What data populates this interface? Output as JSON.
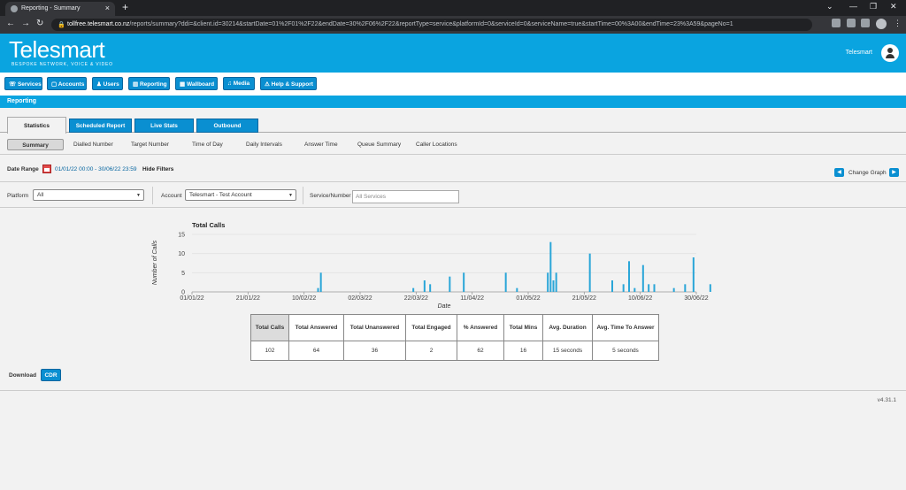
{
  "browser": {
    "tab_title": "Reporting - Summary",
    "url_host": "tollfree.telesmart.co.nz",
    "url_path": "/reports/summary?ddi=&client.id=30214&startDate=01%2F01%2F22&endDate=30%2F06%2F22&reportType=service&platformId=0&serviceId=0&serviceName=true&startTime=00%3A00&endTime=23%3A59&pageNo=1"
  },
  "header": {
    "logo_name": "Telesmart",
    "logo_tagline": "BESPOKE NETWORK, VOICE & VIDEO",
    "user_name": "Telesmart"
  },
  "menu": {
    "items": [
      "Services",
      "Accounts",
      "Users",
      "Reporting",
      "Wallboard",
      "Media",
      "Help & Support"
    ]
  },
  "section_title": "Reporting",
  "tabs": [
    "Statistics",
    "Scheduled Report",
    "Live Stats",
    "Outbound"
  ],
  "subtabs": [
    "Summary",
    "Dialled Number",
    "Target Number",
    "Time of Day",
    "Daily Intervals",
    "Answer Time",
    "Queue Summary",
    "Caller Locations"
  ],
  "date_range": {
    "label": "Date Range",
    "value": "01/01/22 00:00 - 30/06/22 23:59",
    "hide_filters": "Hide Filters",
    "change_graph": "Change Graph"
  },
  "filters": {
    "platform_label": "Platform",
    "platform_value": "All",
    "account_label": "Account",
    "account_value": "Telesmart - Test Account",
    "service_label": "Service/Number",
    "service_placeholder": "All Services"
  },
  "chart_data": {
    "type": "bar",
    "title": "Total Calls",
    "xlabel": "Date",
    "ylabel": "Number of Calls",
    "ylim": [
      0,
      15
    ],
    "yticks": [
      0,
      5,
      10,
      15
    ],
    "x_range": [
      "01/01/22",
      "30/06/22"
    ],
    "xticks": [
      "01/01/22",
      "21/01/22",
      "10/02/22",
      "02/03/22",
      "22/03/22",
      "11/04/22",
      "01/05/22",
      "21/05/22",
      "10/06/22",
      "30/06/22"
    ],
    "color": "#2aa6d8",
    "grid": true,
    "points": [
      {
        "x": "15/02/22",
        "y": 1
      },
      {
        "x": "16/02/22",
        "y": 5
      },
      {
        "x": "21/03/22",
        "y": 1
      },
      {
        "x": "25/03/22",
        "y": 3
      },
      {
        "x": "27/03/22",
        "y": 2
      },
      {
        "x": "03/04/22",
        "y": 4
      },
      {
        "x": "08/04/22",
        "y": 5
      },
      {
        "x": "23/04/22",
        "y": 5
      },
      {
        "x": "27/04/22",
        "y": 1
      },
      {
        "x": "08/05/22",
        "y": 5
      },
      {
        "x": "09/05/22",
        "y": 13
      },
      {
        "x": "10/05/22",
        "y": 3
      },
      {
        "x": "11/05/22",
        "y": 5
      },
      {
        "x": "23/05/22",
        "y": 10
      },
      {
        "x": "31/05/22",
        "y": 3
      },
      {
        "x": "04/06/22",
        "y": 2
      },
      {
        "x": "06/06/22",
        "y": 8
      },
      {
        "x": "08/06/22",
        "y": 1
      },
      {
        "x": "11/06/22",
        "y": 7
      },
      {
        "x": "13/06/22",
        "y": 2
      },
      {
        "x": "15/06/22",
        "y": 2
      },
      {
        "x": "22/06/22",
        "y": 1
      },
      {
        "x": "26/06/22",
        "y": 2
      },
      {
        "x": "29/06/22",
        "y": 9
      },
      {
        "x": "05/07/22",
        "y": 2
      }
    ]
  },
  "stats": {
    "headers": [
      "Total Calls",
      "Total Answered",
      "Total Unanswered",
      "Total Engaged",
      "% Answered",
      "Total Mins",
      "Avg. Duration",
      "Avg. Time To Answer"
    ],
    "values": [
      "102",
      "64",
      "36",
      "2",
      "62",
      "16",
      "15 seconds",
      "5 seconds"
    ]
  },
  "download": {
    "label": "Download",
    "cdr_button": "CDR"
  },
  "version": "v4.31.1"
}
